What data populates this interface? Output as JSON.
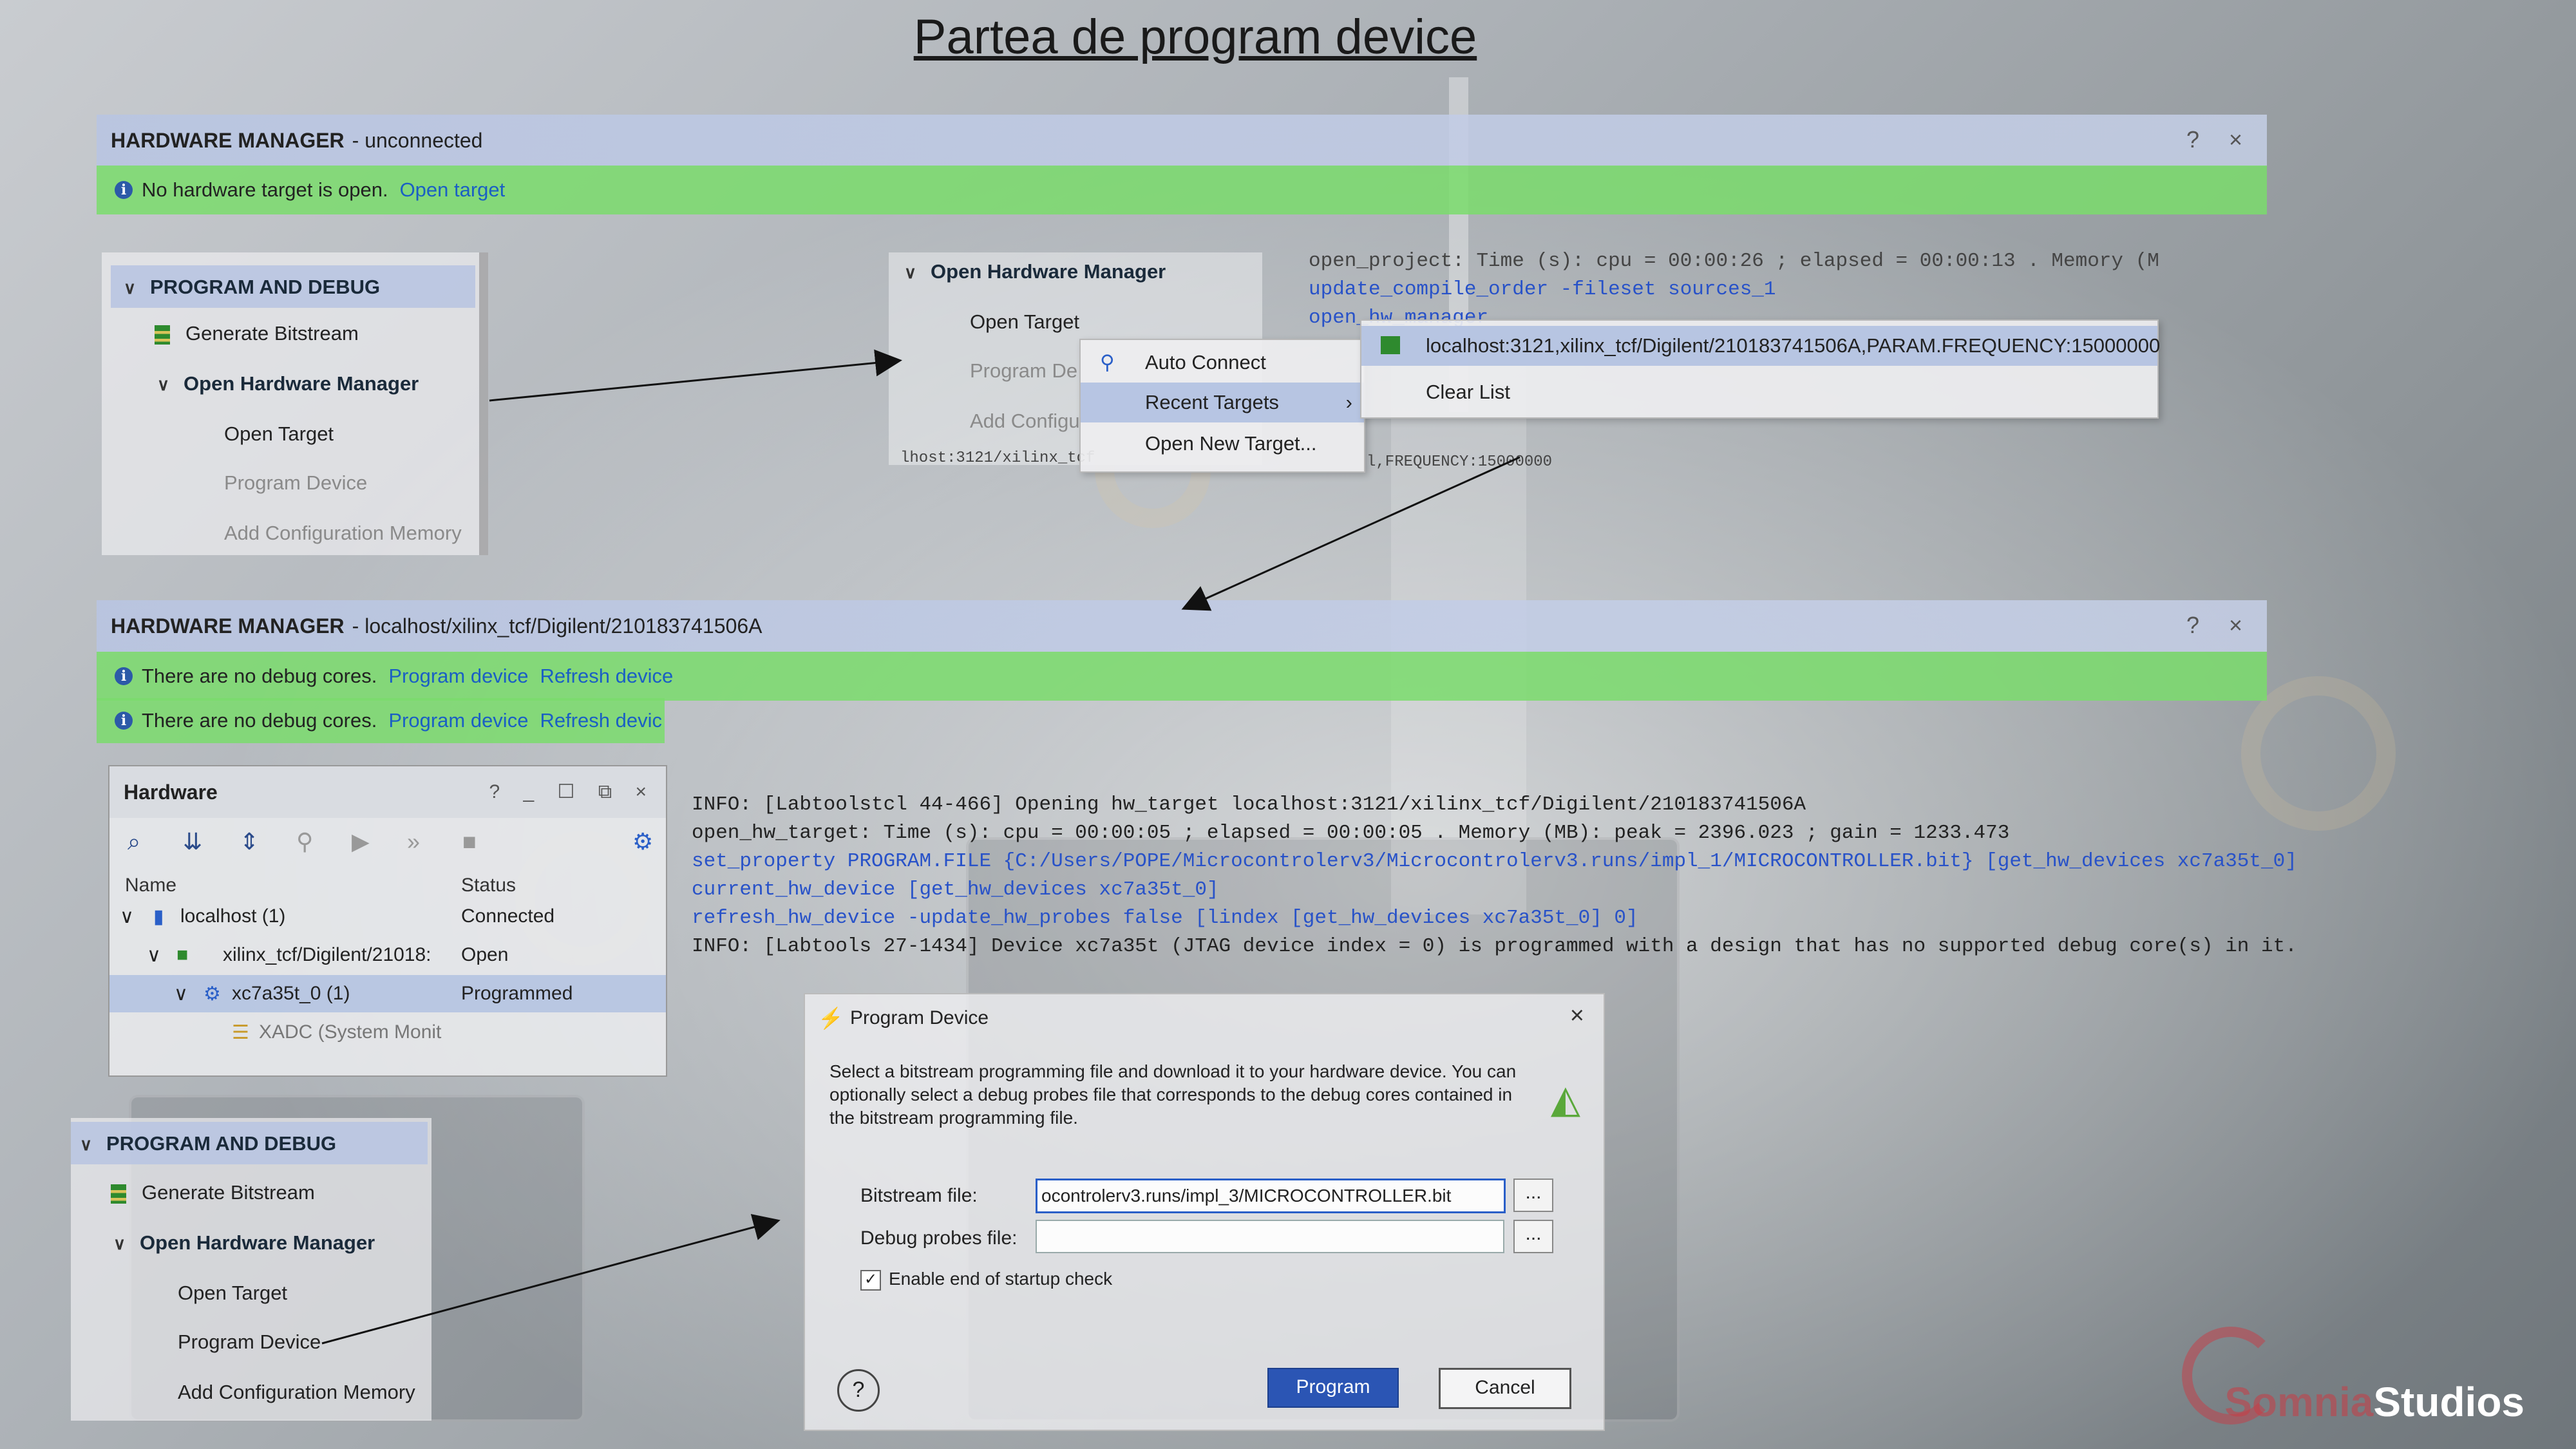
{
  "slide": {
    "title": "Partea de program device"
  },
  "hm_top": {
    "title_bold": "HARDWARE MANAGER",
    "title_rest": "- unconnected",
    "controls": "? ×",
    "info_text": "No hardware target is open.",
    "info_link": "Open target"
  },
  "flow_top": {
    "header": "PROGRAM AND DEBUG",
    "items": [
      "Generate Bitstream",
      "Open Hardware Manager",
      "Open Target",
      "Program Device",
      "Add Configuration Memory"
    ]
  },
  "flow_mid": {
    "header": "Open Hardware Manager",
    "items": [
      "Open Target",
      "Program De",
      "Add Configu"
    ],
    "clipped": "lhost:3121/xilinx_tcf"
  },
  "menu1": {
    "items": [
      "Auto Connect",
      "Recent Targets",
      "Open New Target..."
    ]
  },
  "menu2": {
    "items": [
      "localhost:3121,xilinx_tcf/Digilent/210183741506A,PARAM.FREQUENCY:15000000",
      "Clear List"
    ],
    "clipped": "l,FREQUENCY:15000000"
  },
  "console_top": {
    "lines": [
      "open_project: Time (s): cpu = 00:00:26 ; elapsed = 00:00:13 . Memory (M",
      "update_compile_order -fileset sources_1",
      "open_hw_manager"
    ]
  },
  "hm_second": {
    "title_bold": "HARDWARE MANAGER",
    "title_rest": "- localhost/xilinx_tcf/Digilent/210183741506A",
    "controls": "? ×",
    "info_text": "There are no debug cores.",
    "link1": "Program device",
    "link2": "Refresh device"
  },
  "info_repeat": {
    "text": "There are no debug cores.",
    "link1": "Program device",
    "link2": "Refresh devic"
  },
  "hardware": {
    "title": "Hardware",
    "controls": "? _ ☐ ⧉ ×",
    "col_name": "Name",
    "col_status": "Status",
    "rows": [
      {
        "name": "localhost (1)",
        "status": "Connected"
      },
      {
        "name": "xilinx_tcf/Digilent/21018:",
        "status": "Open"
      },
      {
        "name": "xc7a35t_0 (1)",
        "status": "Programmed"
      },
      {
        "name": "XADC (System Monit",
        "status": ""
      }
    ]
  },
  "console_main": {
    "lines": [
      "INFO: [Labtoolstcl 44-466] Opening hw_target localhost:3121/xilinx_tcf/Digilent/210183741506A",
      "open_hw_target: Time (s): cpu = 00:00:05 ; elapsed = 00:00:05 . Memory (MB): peak = 2396.023 ; gain = 1233.473",
      "set_property PROGRAM.FILE {C:/Users/POPE/Microcontrolerv3/Microcontrolerv3.runs/impl_1/MICROCONTROLLER.bit} [get_hw_devices xc7a35t_0]",
      "current_hw_device [get_hw_devices xc7a35t_0]",
      "refresh_hw_device -update_hw_probes false [lindex [get_hw_devices xc7a35t_0] 0]",
      "INFO: [Labtools 27-1434] Device xc7a35t (JTAG device index = 0) is programmed with a design that has no supported debug core(s) in it."
    ]
  },
  "flow_bottom": {
    "header": "PROGRAM AND DEBUG",
    "items": [
      "Generate Bitstream",
      "Open Hardware Manager",
      "Open Target",
      "Program Device",
      "Add Configuration Memory"
    ]
  },
  "dialog": {
    "title": "Program Device",
    "description": "Select a bitstream programming file and download it to your hardware device. You can optionally select a debug probes file that corresponds to the debug cores contained in the bitstream programming file.",
    "bitstream_label": "Bitstream file:",
    "bitstream_value": "ocontrolerv3.runs/impl_3/MICROCONTROLLER.bit",
    "probes_label": "Debug probes file:",
    "probes_value": "",
    "browse_label": "...",
    "checkbox_label": "Enable end of startup check",
    "help_label": "?",
    "program_label": "Program",
    "cancel_label": "Cancel",
    "close": "×"
  },
  "logo": {
    "text_faint": "Somnia",
    "text": "Studios"
  },
  "colors": {
    "link": "#1a5fc4",
    "green": "#7adc6c",
    "header": "#b9c5e1",
    "primary": "#2b55b4",
    "cmd": "#2852c8"
  }
}
